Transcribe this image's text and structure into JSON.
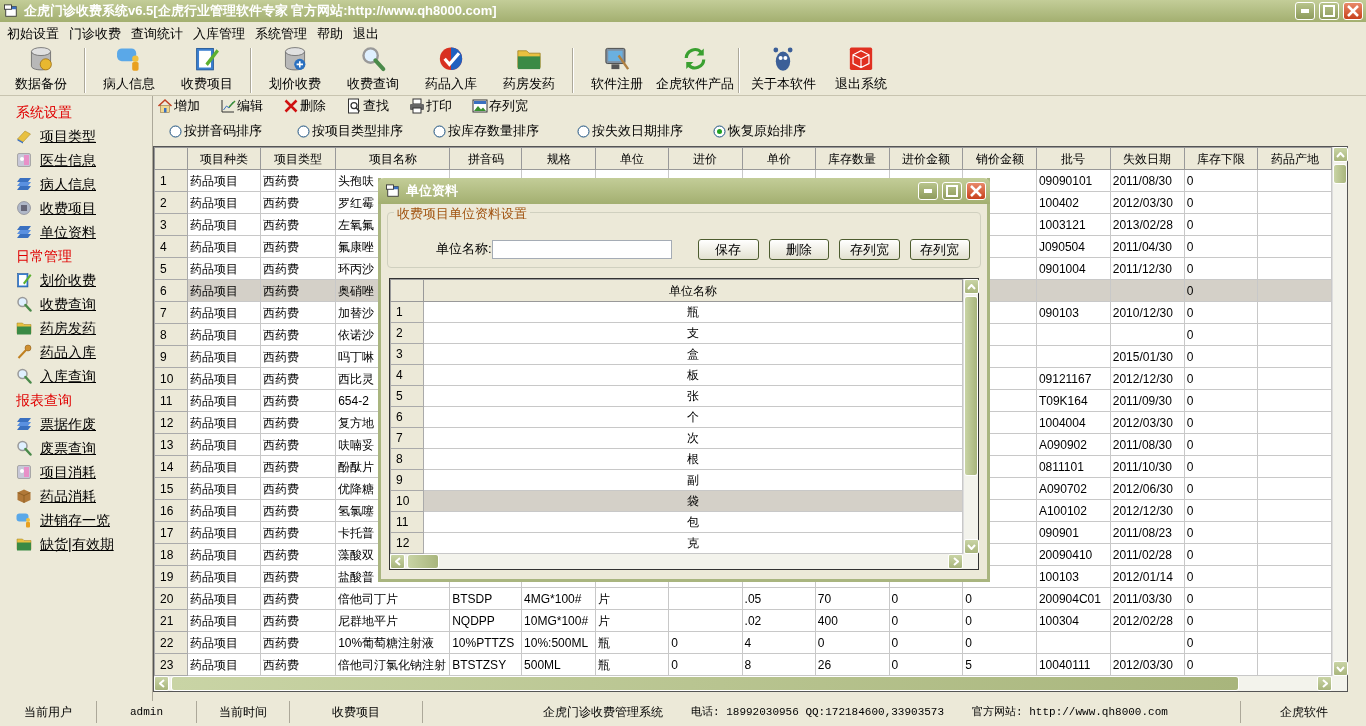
{
  "window": {
    "title": "企虎门诊收费系统v6.5[企虎行业管理软件专家 官方网站:http://www.qh8000.com]"
  },
  "menu": [
    "初始设置",
    "门诊收费",
    "查询统计",
    "入库管理",
    "系统管理",
    "帮助",
    "退出"
  ],
  "toolbar": {
    "groups": [
      [
        "数据备份"
      ],
      [
        "病人信息",
        "收费项目"
      ],
      [
        "划价收费",
        "收费查询",
        "药品入库",
        "药房发药"
      ],
      [
        "软件注册",
        "企虎软件产品"
      ],
      [
        "关于本软件",
        "退出系统"
      ]
    ]
  },
  "sidebar": {
    "sections": [
      {
        "title": "系统设置",
        "items": [
          "项目类型",
          "医生信息",
          "病人信息",
          "收费项目",
          "单位资料"
        ]
      },
      {
        "title": "日常管理",
        "items": [
          "划价收费",
          "收费查询",
          "药房发药",
          "药品入库",
          "入库查询"
        ]
      },
      {
        "title": "报表查询",
        "items": [
          "票据作废",
          "废票查询",
          "项目消耗",
          "药品消耗",
          "进销存一览",
          "缺货|有效期"
        ]
      }
    ]
  },
  "actions": [
    "增加",
    "编辑",
    "删除",
    "查找",
    "打印",
    "存列宽"
  ],
  "sort_options": [
    {
      "label": "按拼音码排序",
      "selected": false
    },
    {
      "label": "按项目类型排序",
      "selected": false
    },
    {
      "label": "按库存数量排序",
      "selected": false
    },
    {
      "label": "按失效日期排序",
      "selected": false
    },
    {
      "label": "恢复原始排序",
      "selected": true
    }
  ],
  "table": {
    "columns": [
      "项目种类",
      "项目类型",
      "项目名称",
      "拼音码",
      "规格",
      "单位",
      "进价",
      "单价",
      "库存数量",
      "进价金额",
      "销价金额",
      "批号",
      "失效日期",
      "库存下限",
      "药品产地"
    ],
    "rows": [
      {
        "number": "1",
        "selected": false,
        "cells": [
          "药品项目",
          "西药费",
          "头孢呋",
          null,
          null,
          null,
          null,
          null,
          null,
          null,
          null,
          "09090101",
          "2011/08/30",
          "0"
        ]
      },
      {
        "number": "2",
        "selected": false,
        "cells": [
          "药品项目",
          "西药费",
          "罗红霉",
          null,
          null,
          null,
          null,
          null,
          null,
          null,
          null,
          "100402",
          "2012/03/30",
          "0"
        ]
      },
      {
        "number": "3",
        "selected": false,
        "cells": [
          "药品项目",
          "西药费",
          "左氧氟",
          null,
          null,
          null,
          null,
          null,
          null,
          null,
          null,
          "1003121",
          "2013/02/28",
          "0"
        ]
      },
      {
        "number": "4",
        "selected": false,
        "cells": [
          "药品项目",
          "西药费",
          "氟康唑",
          null,
          null,
          null,
          null,
          null,
          null,
          null,
          null,
          "J090504",
          "2011/04/30",
          "0"
        ]
      },
      {
        "number": "5",
        "selected": false,
        "cells": [
          "药品项目",
          "西药费",
          "环丙沙",
          null,
          null,
          null,
          null,
          null,
          null,
          null,
          null,
          "0901004",
          "2011/12/30",
          "0"
        ]
      },
      {
        "number": "6",
        "selected": true,
        "cells": [
          "药品项目",
          "西药费",
          "奥硝唑",
          null,
          null,
          null,
          null,
          null,
          null,
          null,
          null,
          null,
          null,
          "0"
        ]
      },
      {
        "number": "7",
        "selected": false,
        "cells": [
          "药品项目",
          "西药费",
          "加替沙",
          null,
          null,
          null,
          null,
          null,
          null,
          null,
          null,
          "090103",
          "2010/12/30",
          "0"
        ]
      },
      {
        "number": "8",
        "selected": false,
        "cells": [
          "药品项目",
          "西药费",
          "依诺沙",
          null,
          null,
          null,
          null,
          null,
          null,
          null,
          null,
          null,
          null,
          "0"
        ]
      },
      {
        "number": "9",
        "selected": false,
        "cells": [
          "药品项目",
          "西药费",
          "吗丁啉",
          null,
          null,
          null,
          null,
          null,
          null,
          null,
          null,
          null,
          "2015/01/30",
          "0"
        ]
      },
      {
        "number": "10",
        "selected": false,
        "cells": [
          "药品项目",
          "西药费",
          "西比灵",
          null,
          null,
          null,
          null,
          null,
          null,
          null,
          null,
          "09121167",
          "2012/12/30",
          "0"
        ]
      },
      {
        "number": "11",
        "selected": false,
        "cells": [
          "药品项目",
          "西药费",
          "654-2",
          null,
          null,
          null,
          null,
          null,
          null,
          null,
          null,
          "T09K164",
          "2011/09/30",
          "0"
        ]
      },
      {
        "number": "12",
        "selected": false,
        "cells": [
          "药品项目",
          "西药费",
          "复方地",
          null,
          null,
          null,
          null,
          null,
          null,
          null,
          null,
          "1004004",
          "2012/03/30",
          "0"
        ]
      },
      {
        "number": "13",
        "selected": false,
        "cells": [
          "药品项目",
          "西药费",
          "呋喃妥",
          null,
          null,
          null,
          null,
          null,
          null,
          null,
          null,
          "A090902",
          "2011/08/30",
          "0"
        ]
      },
      {
        "number": "14",
        "selected": false,
        "cells": [
          "药品项目",
          "西药费",
          "酚酞片",
          null,
          null,
          null,
          null,
          null,
          null,
          null,
          null,
          "0811101",
          "2011/10/30",
          "0"
        ]
      },
      {
        "number": "15",
        "selected": false,
        "cells": [
          "药品项目",
          "西药费",
          "优降糖",
          null,
          null,
          null,
          null,
          null,
          null,
          null,
          null,
          "A090702",
          "2012/06/30",
          "0"
        ]
      },
      {
        "number": "16",
        "selected": false,
        "cells": [
          "药品项目",
          "西药费",
          "氢氯噻",
          null,
          null,
          null,
          null,
          null,
          null,
          null,
          null,
          "A100102",
          "2012/12/30",
          "0"
        ]
      },
      {
        "number": "17",
        "selected": false,
        "cells": [
          "药品项目",
          "西药费",
          "卡托普",
          null,
          null,
          null,
          null,
          null,
          null,
          null,
          null,
          "090901",
          "2011/08/23",
          "0"
        ]
      },
      {
        "number": "18",
        "selected": false,
        "cells": [
          "药品项目",
          "西药费",
          "藻酸双",
          null,
          null,
          null,
          null,
          null,
          null,
          null,
          null,
          "20090410",
          "2011/02/28",
          "0"
        ]
      },
      {
        "number": "19",
        "selected": false,
        "cells": [
          "药品项目",
          "西药费",
          "盐酸普",
          null,
          null,
          null,
          null,
          null,
          null,
          null,
          null,
          "100103",
          "2012/01/14",
          "0"
        ]
      },
      {
        "number": "20",
        "selected": false,
        "cells": [
          "药品项目",
          "西药费",
          "倍他司丁片",
          "BTSDP",
          "4MG*100#",
          "片",
          null,
          ".05",
          "70",
          "0",
          "0",
          "200904C01",
          "2011/03/30",
          "0"
        ]
      },
      {
        "number": "21",
        "selected": false,
        "cells": [
          "药品项目",
          "西药费",
          "尼群地平片",
          "NQDPP",
          "10MG*100#",
          "片",
          null,
          ".02",
          "400",
          "0",
          "0",
          "100304",
          "2012/02/28",
          "0"
        ]
      },
      {
        "number": "22",
        "selected": false,
        "cells": [
          "药品项目",
          "西药费",
          "10%葡萄糖注射液",
          "10%PTTZS",
          "10%:500ML",
          "瓶",
          "0",
          "4",
          "0",
          "0",
          "0",
          null,
          null,
          "0"
        ]
      },
      {
        "number": "23",
        "selected": false,
        "cells": [
          "药品项目",
          "西药费",
          "倍他司汀氯化钠注射",
          "BTSTZSY",
          "500ML",
          "瓶",
          "0",
          "8",
          "26",
          "0",
          "5",
          "10040111",
          "2012/03/30",
          "0"
        ]
      }
    ]
  },
  "dialog": {
    "title": "单位资料",
    "group_title": "收费项目单位资料设置",
    "field": {
      "label": "单位名称:"
    },
    "buttons": [
      "保存",
      "删除",
      "存列宽",
      "存列宽"
    ],
    "grid": {
      "column": "单位名称",
      "rows": [
        {
          "number": "1",
          "name": "瓶",
          "selected": false
        },
        {
          "number": "2",
          "name": "支",
          "selected": false
        },
        {
          "number": "3",
          "name": "盒",
          "selected": false
        },
        {
          "number": "4",
          "name": "板",
          "selected": false
        },
        {
          "number": "5",
          "name": "张",
          "selected": false
        },
        {
          "number": "6",
          "name": "个",
          "selected": false
        },
        {
          "number": "7",
          "name": "次",
          "selected": false
        },
        {
          "number": "8",
          "name": "根",
          "selected": false
        },
        {
          "number": "9",
          "name": "副",
          "selected": false
        },
        {
          "number": "10",
          "name": "袋",
          "selected": true
        },
        {
          "number": "11",
          "name": "包",
          "selected": false
        },
        {
          "number": "12",
          "name": "克",
          "selected": false
        }
      ]
    }
  },
  "status_bar": [
    "当前用户",
    "admin",
    "当前时间",
    "收费项目",
    "企虎门诊收费管理系统",
    "电话: 18992030956 QQ:172184600,33903573",
    "官方网站: http://www.qh8000.com",
    "企虎软件"
  ]
}
